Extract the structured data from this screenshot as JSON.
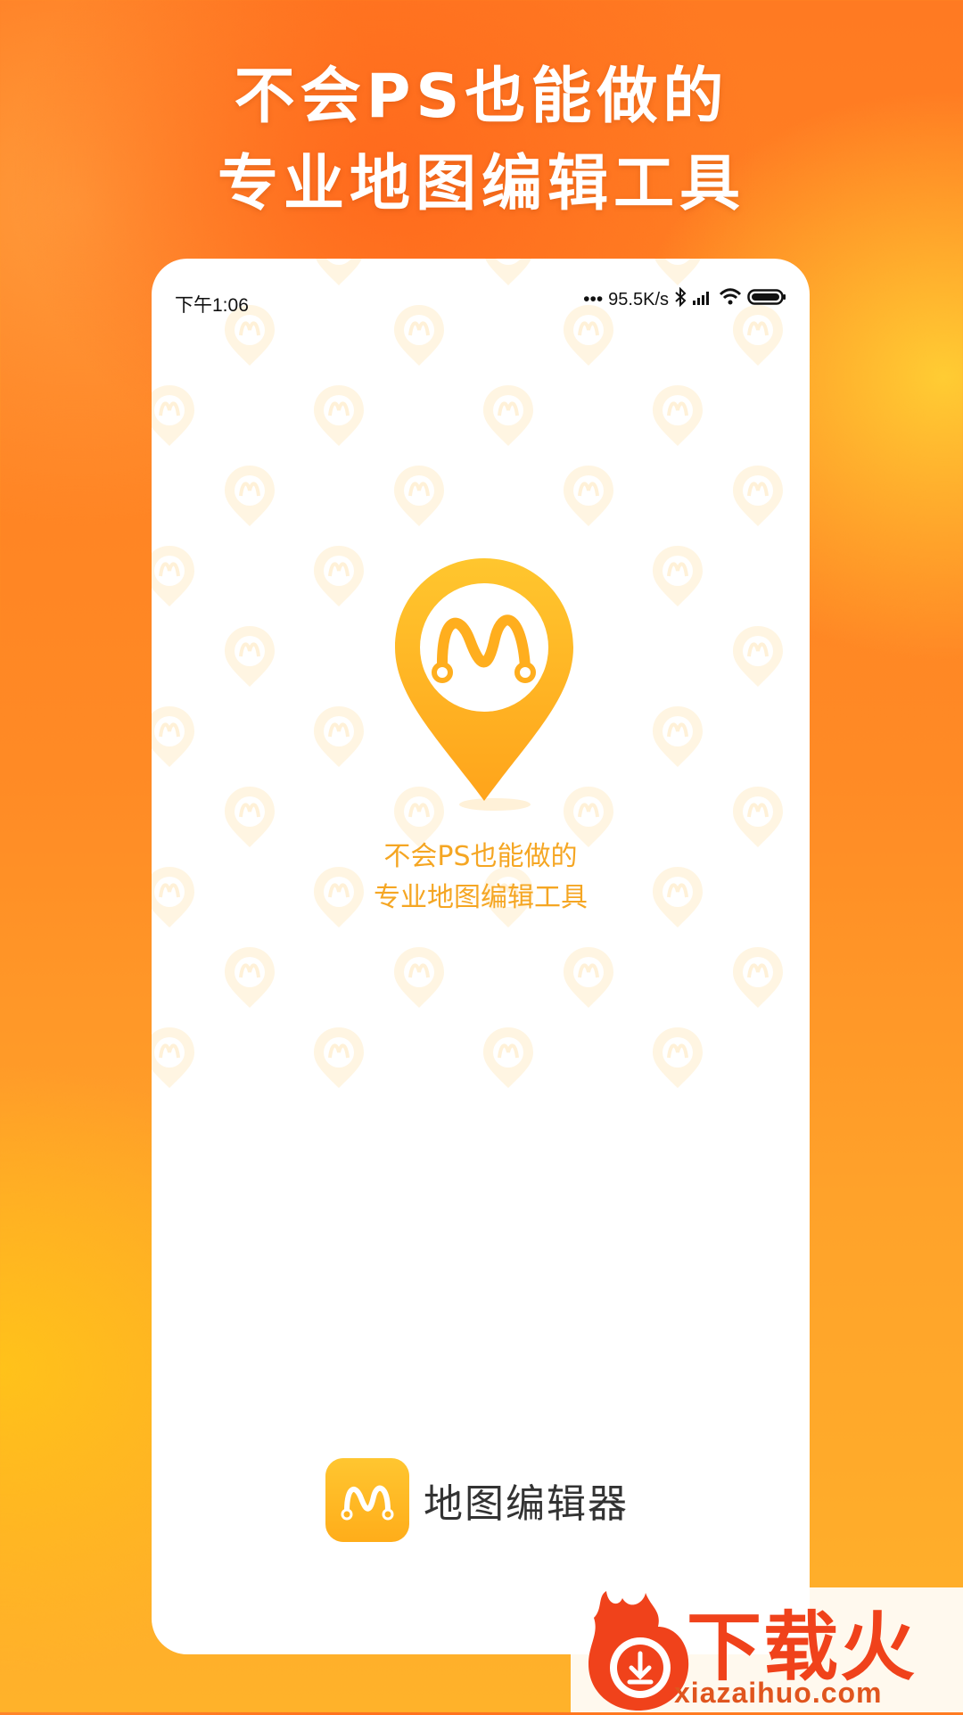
{
  "promo": {
    "headline_line1": "不会PS也能做的",
    "headline_line2": "专业地图编辑工具"
  },
  "status_bar": {
    "time": "下午1:06",
    "signal_dots": "•••",
    "network_speed": "95.5K/s",
    "icons": [
      "bluetooth-icon",
      "cellular-signal-icon",
      "wifi-icon",
      "battery-icon"
    ]
  },
  "splash": {
    "logo_icon": "map-pin-m-logo",
    "tagline_line1": "不会PS也能做的",
    "tagline_line2": "专业地图编辑工具"
  },
  "brand": {
    "app_icon": "app-m-icon",
    "app_name": "地图编辑器"
  },
  "watermark": {
    "title": "下载火",
    "url": "xiazaihuo.com"
  },
  "colors": {
    "accent": "#f5a623",
    "pin_yellow": "#ffb21c",
    "watermark_red": "#f0421b"
  }
}
